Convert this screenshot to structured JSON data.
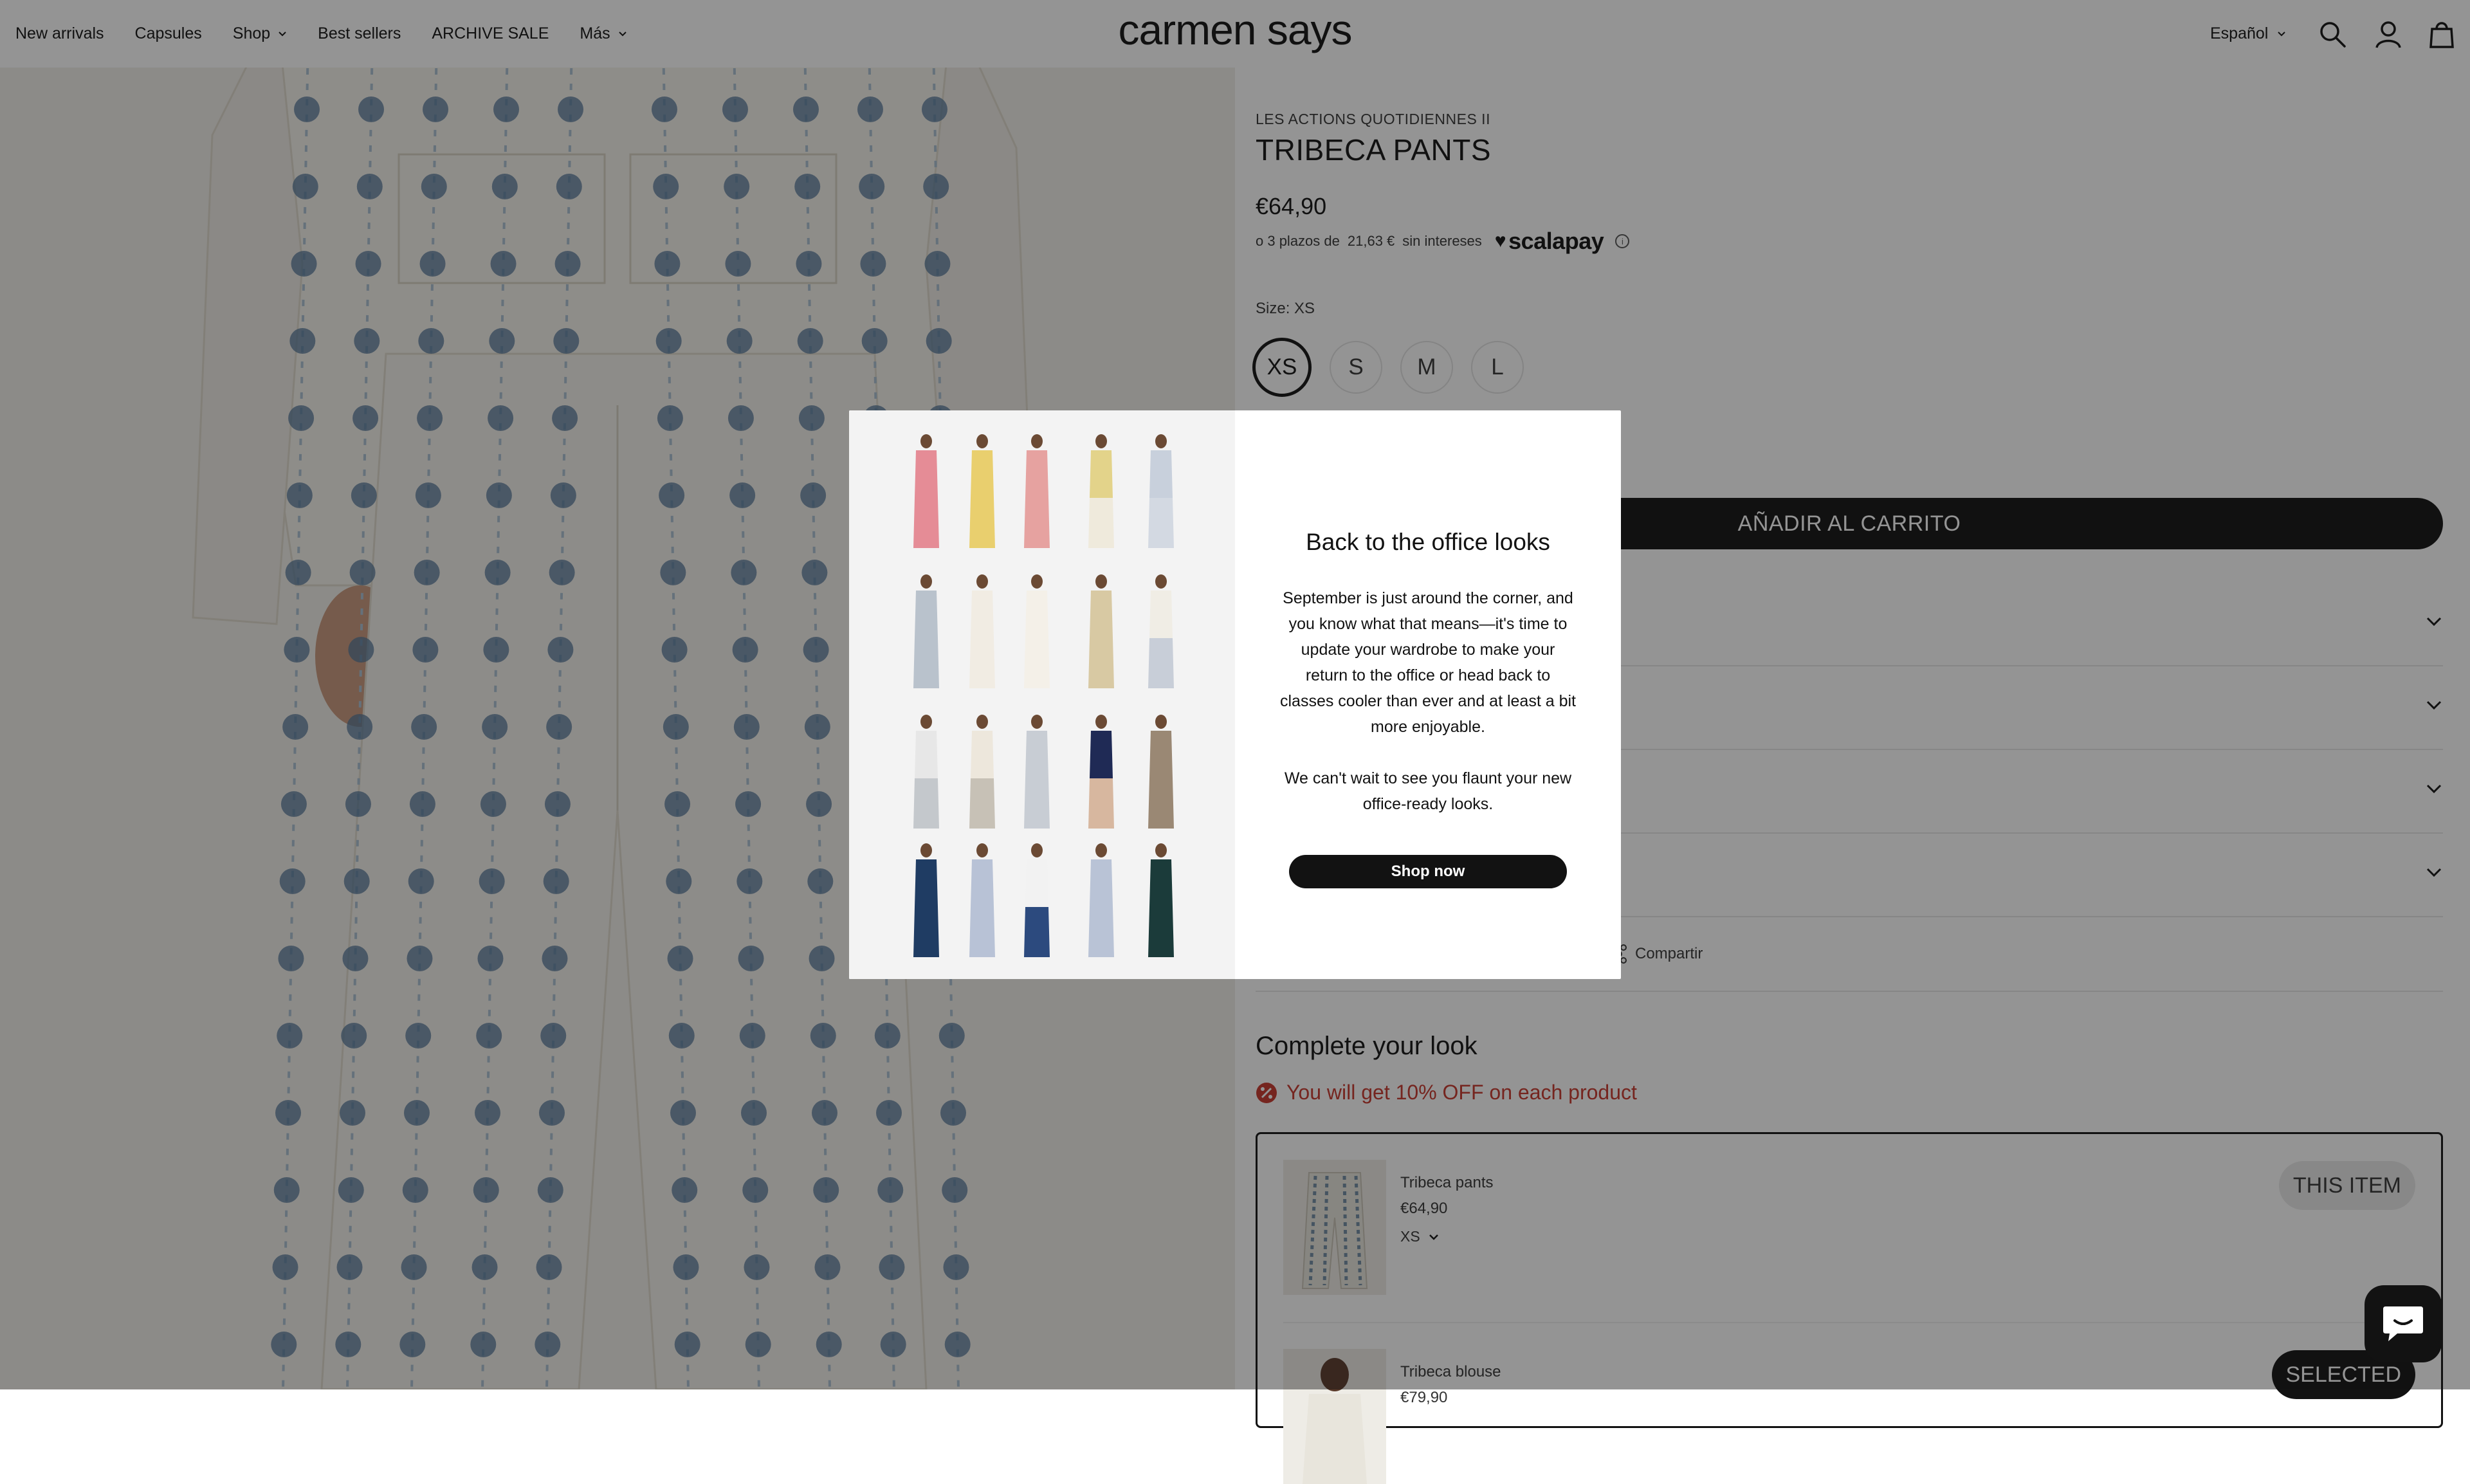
{
  "header": {
    "nav": [
      {
        "label": "New arrivals",
        "has_dropdown": false
      },
      {
        "label": "Capsules",
        "has_dropdown": false
      },
      {
        "label": "Shop",
        "has_dropdown": true
      },
      {
        "label": "Best sellers",
        "has_dropdown": false
      },
      {
        "label": "ARCHIVE SALE",
        "has_dropdown": false
      },
      {
        "label": "Más",
        "has_dropdown": true
      }
    ],
    "logo": "carmen says",
    "language": "Español",
    "icons": [
      "search-icon",
      "account-icon",
      "cart-icon"
    ]
  },
  "product": {
    "collection": "LES ACTIONS QUOTIDIENNES II",
    "title": "TRIBECA PANTS",
    "price": "€64,90",
    "installments": {
      "prefix": "o 3 plazos de",
      "amount": "21,63 €",
      "suffix": "sin intereses",
      "provider": "scalapay"
    },
    "size_label": "Size: XS",
    "sizes": [
      "XS",
      "S",
      "M",
      "L"
    ],
    "selected_size": "XS",
    "add_to_cart": "AÑADIR AL CARRITO",
    "share": "Compartir"
  },
  "complete_look": {
    "title": "Complete your look",
    "offer": "You will get 10% OFF on each product",
    "items": [
      {
        "name": "Tribeca pants",
        "price": "€64,90",
        "size": "XS",
        "badge": "THIS ITEM"
      },
      {
        "name": "Tribeca blouse",
        "price": "€79,90",
        "badge": "SELECTED"
      }
    ]
  },
  "modal": {
    "title": "Back to the office looks",
    "text1": "September is just around the corner, and you know what that means—it's time to update your wardrobe to make your return to the office or head back to classes cooler than ever and at least a bit more enjoyable.",
    "text2": "We can't wait to see you flaunt your new office-ready looks.",
    "button": "Shop now"
  },
  "colors": {
    "text": "#121212",
    "button_bg": "#121212",
    "offer_red": "#c7352b",
    "print_blue": "#4f7396",
    "fabric": "#f1efe9",
    "overlay": "rgba(18,18,18,0.45)"
  }
}
